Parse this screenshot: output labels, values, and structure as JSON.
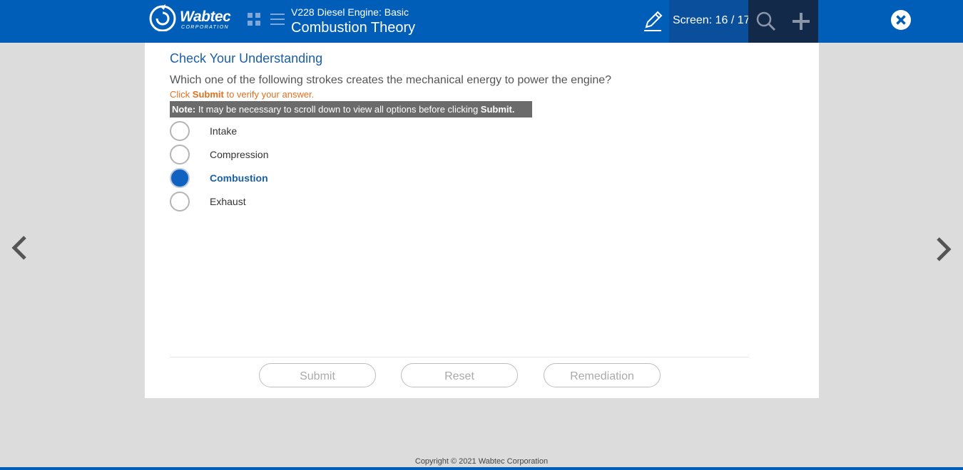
{
  "header": {
    "logo_text": "Wabtec",
    "logo_sub": "CORPORATION",
    "course_title": "V228 Diesel Engine: Basic",
    "module_title": "Combustion Theory",
    "screen_label": "Screen: 16 / 17"
  },
  "icons": {
    "grid": "grid-icon",
    "menu": "menu-icon",
    "notes": "pencil-icon",
    "search": "search-icon",
    "expand": "plus-icon",
    "close": "close-icon",
    "prev": "chevron-left-icon",
    "next": "chevron-right-icon"
  },
  "quiz": {
    "section_title": "Check Your Understanding",
    "question": "Which one of the following strokes creates the mechanical energy to power the engine?",
    "instruction_pre": "Click ",
    "instruction_bold": "Submit",
    "instruction_post": " to verify your answer.",
    "note_label": "Note:",
    "note_text": " It may be necessary to scroll down to view all options before clicking ",
    "note_bold": "Submit.",
    "options": [
      {
        "label": "Intake",
        "selected": false
      },
      {
        "label": "Compression",
        "selected": false
      },
      {
        "label": "Combustion",
        "selected": true
      },
      {
        "label": "Exhaust",
        "selected": false
      }
    ]
  },
  "buttons": {
    "submit": "Submit",
    "reset": "Reset",
    "remediation": "Remediation"
  },
  "footer": {
    "copyright": "Copyright © 2021 Wabtec Corporation"
  },
  "colors": {
    "header_bg": "#005eb8",
    "screen_box_bg": "#0a4f9c",
    "dark_box_bg": "#12294a",
    "accent": "#1a5fa8",
    "instruction": "#e07020",
    "selected_radio": "#0f62c0"
  }
}
